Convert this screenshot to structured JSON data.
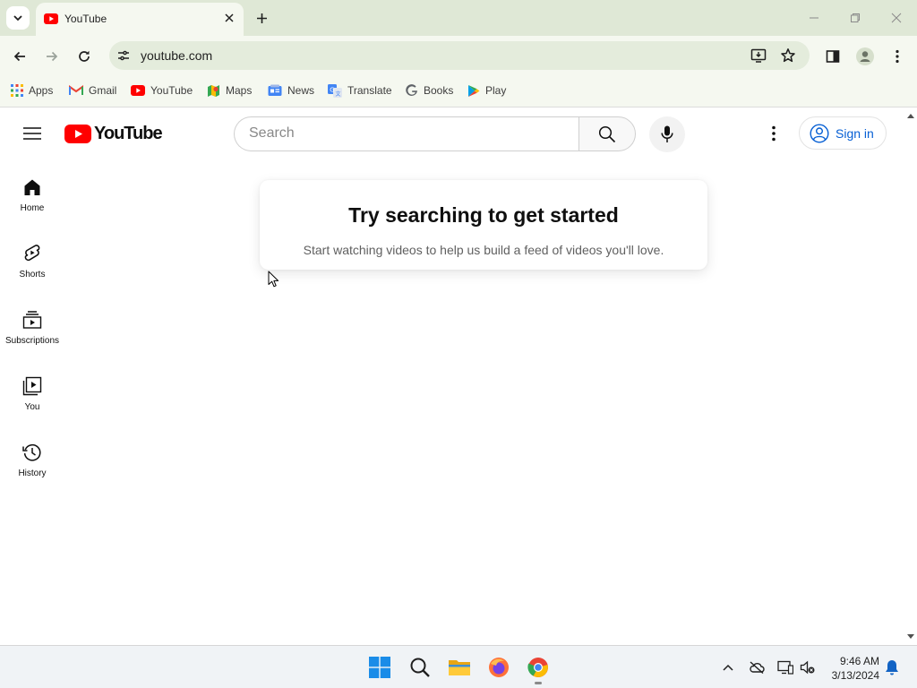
{
  "browser": {
    "tab": {
      "title": "YouTube",
      "favicon": "youtube-icon"
    },
    "url": "youtube.com",
    "bookmarks": [
      {
        "label": "Apps",
        "icon": "apps-grid-icon"
      },
      {
        "label": "Gmail",
        "icon": "gmail-icon"
      },
      {
        "label": "YouTube",
        "icon": "youtube-icon"
      },
      {
        "label": "Maps",
        "icon": "maps-icon"
      },
      {
        "label": "News",
        "icon": "news-icon"
      },
      {
        "label": "Translate",
        "icon": "translate-icon"
      },
      {
        "label": "Books",
        "icon": "google-g-icon"
      },
      {
        "label": "Play",
        "icon": "play-store-icon"
      }
    ]
  },
  "youtube": {
    "logo_text": "YouTube",
    "search": {
      "placeholder": "Search"
    },
    "signin_label": "Sign in",
    "guide": [
      {
        "label": "Home",
        "icon": "home-icon"
      },
      {
        "label": "Shorts",
        "icon": "shorts-icon"
      },
      {
        "label": "Subscriptions",
        "icon": "subscriptions-icon"
      },
      {
        "label": "You",
        "icon": "you-library-icon"
      },
      {
        "label": "History",
        "icon": "history-icon"
      }
    ],
    "promo": {
      "title": "Try searching to get started",
      "body": "Start watching videos to help us build a feed of videos you'll love."
    }
  },
  "taskbar": {
    "time": "9:46 AM",
    "date": "3/13/2024"
  },
  "colors": {
    "brand_red": "#ff0000",
    "link_blue": "#065fd4",
    "chrome_frame": "#dfe8d6",
    "chrome_toolbar": "#f5f8f0"
  }
}
